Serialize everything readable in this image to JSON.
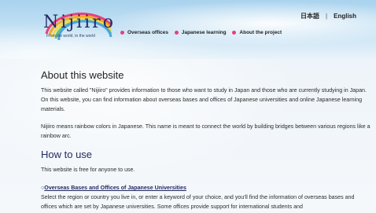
{
  "header": {
    "logo": {
      "text": "Nijiiro",
      "tagline": "From the world, to the world"
    },
    "language": {
      "japanese": "日本語",
      "separator": "|",
      "english": "English"
    },
    "nav": [
      {
        "label": "Overseas offices"
      },
      {
        "label": "Japanese learning"
      },
      {
        "label": "About the project"
      }
    ]
  },
  "main": {
    "about_title": "About this website",
    "about_p1": "This website called \"Nijiiro\" provides information to those who want to study in Japan and those who are currently studying in Japan. On this website, you can find information about overseas bases and offices of Japanese universities and online Japanese learning materials.",
    "about_p2": "Nijiiro means rainbow colors in Japanese. This name is meant to connect the world by building bridges between various regions like a rainbow arc.",
    "howto_title": "How to use",
    "howto_p1": "This website is free for anyone to use.",
    "section_marker": "○",
    "section_link": "Overseas Bases and Offices of Japanese Universities",
    "section_desc": "Select the region or country you live in, or enter a keyword of your choice, and you'll find the information of overseas bases and offices which are set by Japanese universities. Some offices provide support for international students and"
  },
  "colors": {
    "accent_pink": "#e8407a",
    "navy": "#232a62",
    "sky": "#a9d3ee"
  }
}
